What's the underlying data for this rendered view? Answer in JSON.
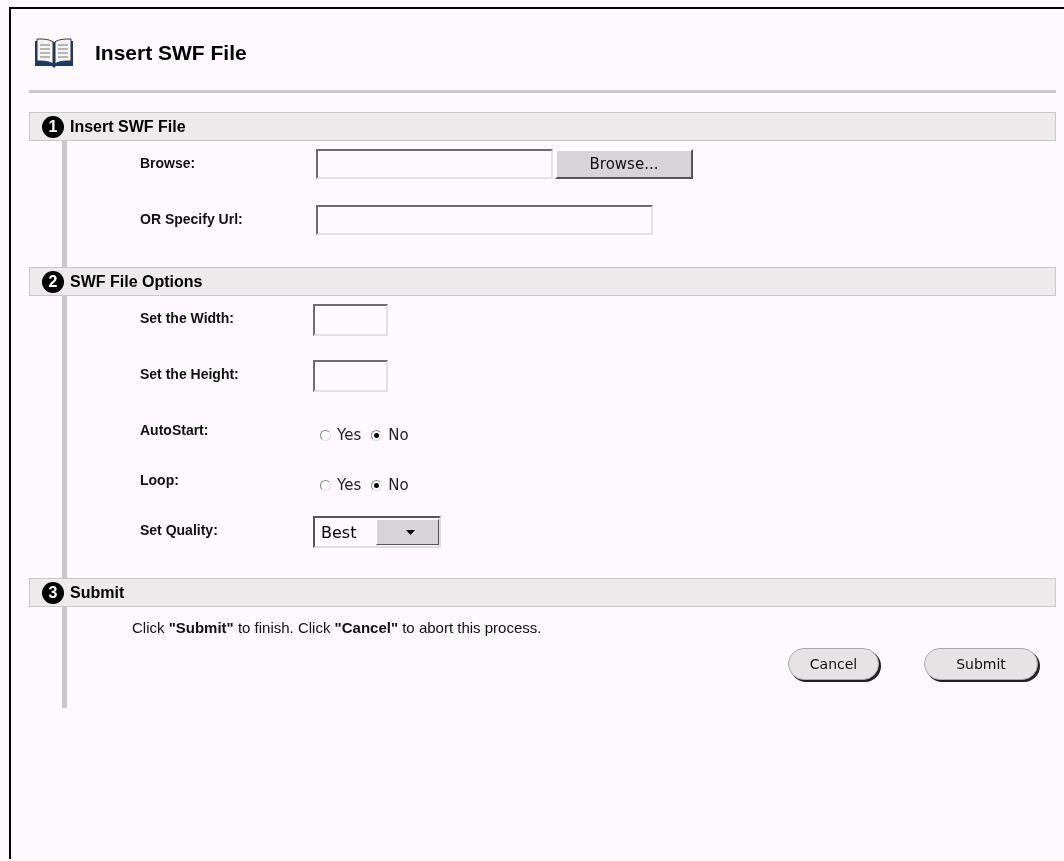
{
  "title": "Insert SWF File",
  "sections": [
    {
      "number": "1",
      "title": "Insert SWF File",
      "rows": [
        {
          "kind": "file",
          "label": "Browse:",
          "button": "Browse..."
        },
        {
          "kind": "text",
          "label": "OR Specify Url:"
        }
      ]
    },
    {
      "number": "2",
      "title": "SWF File Options",
      "rows": [
        {
          "kind": "small-text",
          "label": "Set the Width:"
        },
        {
          "kind": "small-text",
          "label": "Set the Height:"
        },
        {
          "kind": "radio",
          "label": "AutoStart:",
          "options": [
            {
              "label": "Yes",
              "selected": false
            },
            {
              "label": "No",
              "selected": true
            }
          ]
        },
        {
          "kind": "radio",
          "label": "Loop:",
          "options": [
            {
              "label": "Yes",
              "selected": false
            },
            {
              "label": "No",
              "selected": true
            }
          ]
        },
        {
          "kind": "select",
          "label": "Set Quality:",
          "value": "Best"
        }
      ]
    },
    {
      "number": "3",
      "title": "Submit",
      "instruction": "Click **\"Submit\"** to finish. Click **\"Cancel\"** to abort this process.",
      "buttons": [
        "Cancel",
        "Submit"
      ]
    }
  ]
}
